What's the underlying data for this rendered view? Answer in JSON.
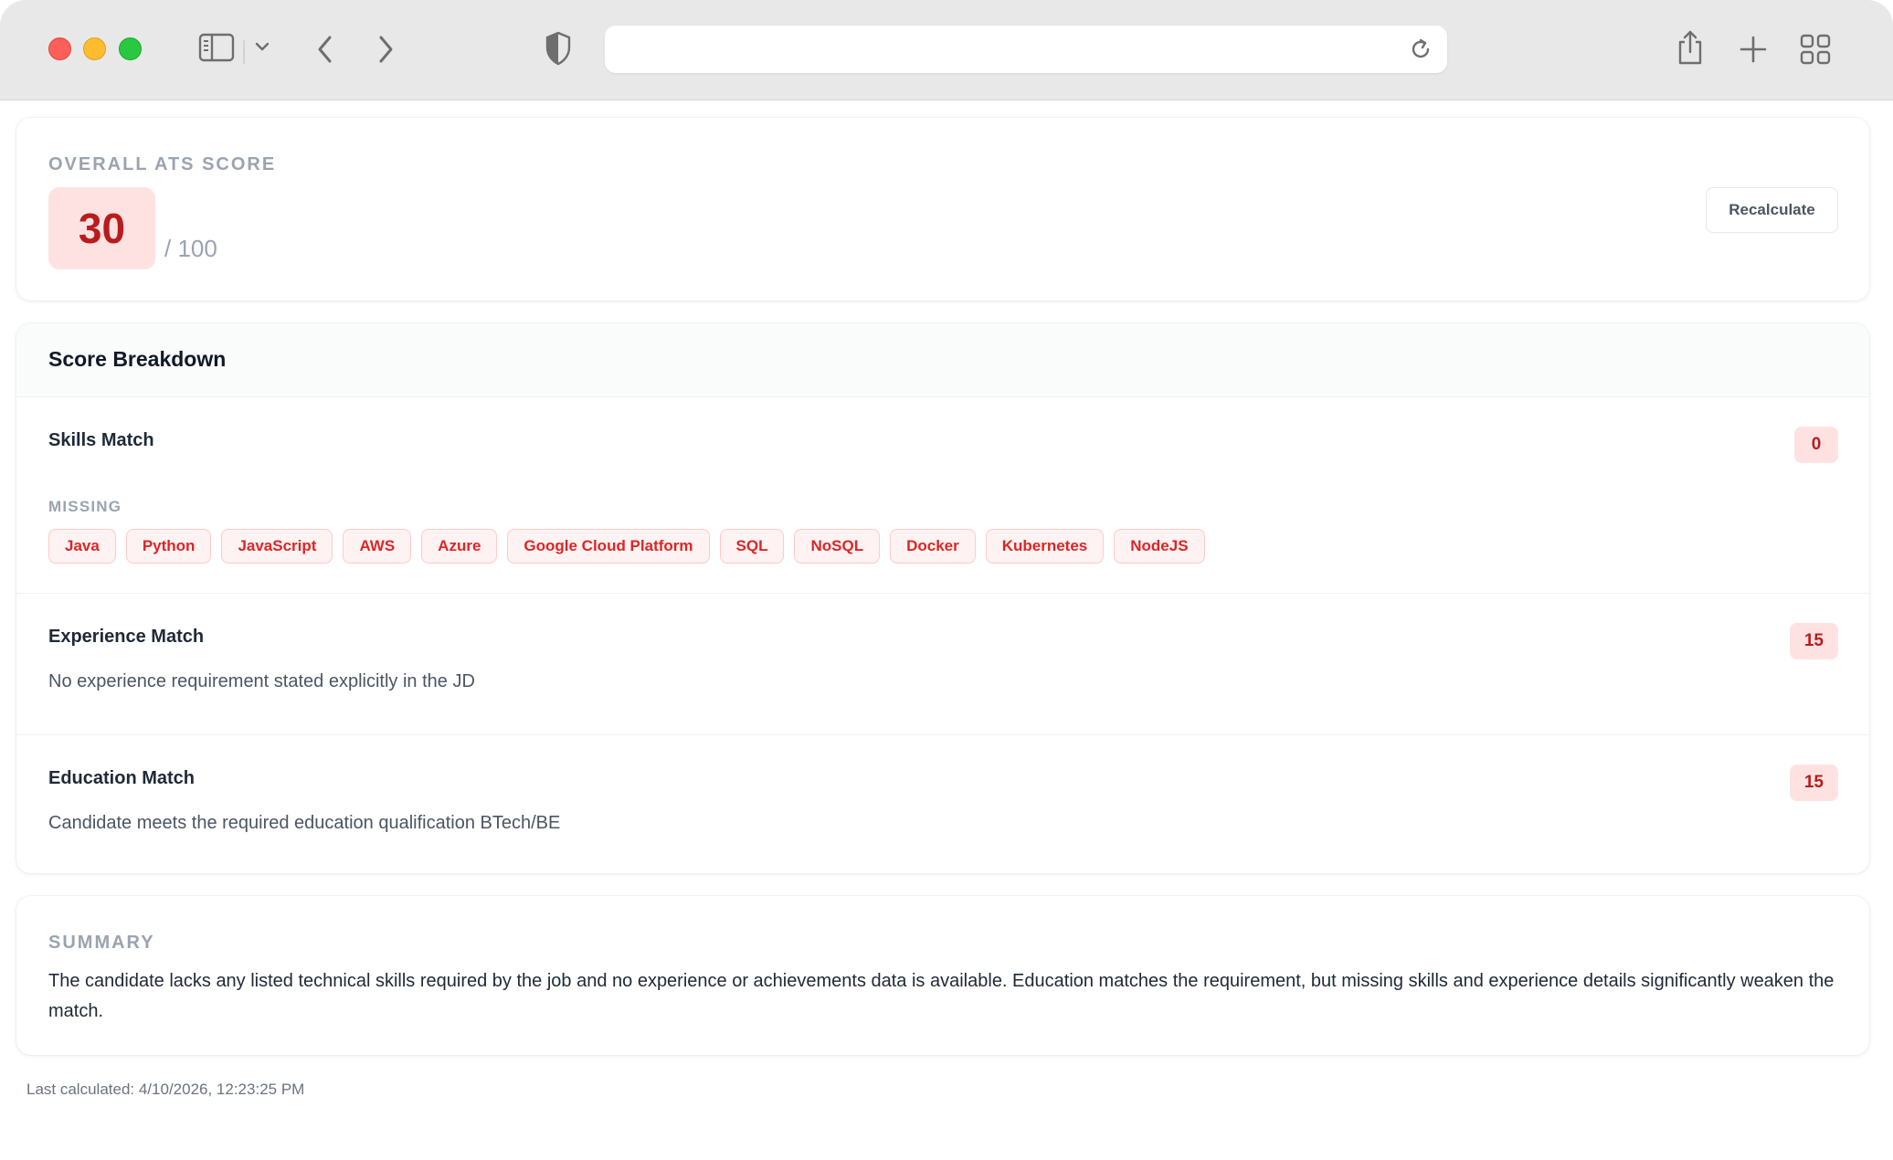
{
  "browser": {
    "address_text": "",
    "icons": [
      "sidebar-icon",
      "chevron-down-icon",
      "back-icon",
      "forward-icon",
      "shield-icon",
      "reload-icon",
      "share-icon",
      "new-tab-icon",
      "tab-overview-icon"
    ]
  },
  "score": {
    "label": "OVERALL ATS SCORE",
    "value": "30",
    "max": "/ 100",
    "recalculate_label": "Recalculate"
  },
  "breakdown": {
    "title": "Score Breakdown",
    "skills": {
      "title": "Skills Match",
      "score": "0",
      "missing_label": "MISSING",
      "missing": [
        "Java",
        "Python",
        "JavaScript",
        "AWS",
        "Azure",
        "Google Cloud Platform",
        "SQL",
        "NoSQL",
        "Docker",
        "Kubernetes",
        "NodeJS"
      ]
    },
    "experience": {
      "title": "Experience Match",
      "score": "15",
      "description": "No experience requirement stated explicitly in the JD"
    },
    "education": {
      "title": "Education Match",
      "score": "15",
      "description": "Candidate meets the required education qualification BTech/BE"
    }
  },
  "summary": {
    "label": "SUMMARY",
    "text": "The candidate lacks any listed technical skills required by the job and no experience or achievements data is available. Education matches the requirement, but missing skills and experience details significantly weaken the match."
  },
  "footer": {
    "last_calculated": "Last calculated: 4/10/2026, 12:23:25 PM"
  },
  "colors": {
    "accent_red": "#b91c1c",
    "chip_red": "#dc2626",
    "badge_bg": "#fee2e2"
  }
}
